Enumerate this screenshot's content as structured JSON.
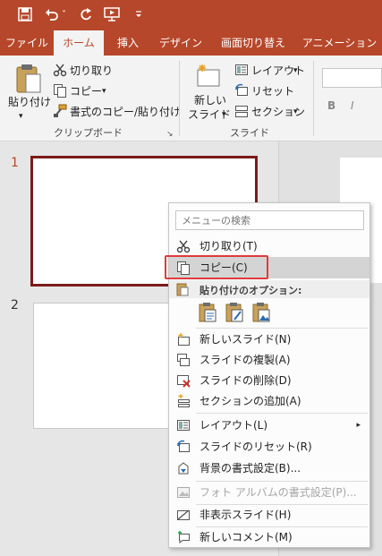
{
  "quick_access": {
    "save_icon": "save-icon",
    "undo_icon": "undo-icon",
    "redo_icon": "redo-icon",
    "present_icon": "present-from-start-icon",
    "customize_icon": "customize-qat-icon",
    "undo_dropdown": "˅"
  },
  "tabs": [
    {
      "label": "ファイル"
    },
    {
      "label": "ホーム"
    },
    {
      "label": "挿入"
    },
    {
      "label": "デザイン"
    },
    {
      "label": "画面切り替え"
    },
    {
      "label": "アニメーション"
    }
  ],
  "ribbon": {
    "clipboard": {
      "paste_label_1": "貼り付け",
      "paste_dropdown": "▾",
      "cut_label": "切り取り",
      "copy_label": "コピー",
      "copy_dropdown": "▾",
      "format_painter_label": "書式のコピー/貼り付け",
      "group_label": "クリップボード",
      "launcher": "↘"
    },
    "slides": {
      "new_slide_line1": "新しい",
      "new_slide_line2": "スライド",
      "new_slide_dropdown": "▾",
      "layout_label": "レイアウト",
      "layout_dropdown": "▾",
      "reset_label": "リセット",
      "section_label": "セクション",
      "section_dropdown": "▾",
      "group_label": "スライド"
    },
    "font": {
      "bold": "B",
      "italic": "I"
    }
  },
  "thumbnails": [
    {
      "number": "1"
    },
    {
      "number": "2"
    }
  ],
  "context_menu": {
    "search_placeholder": "メニューの検索",
    "items": {
      "cut": "切り取り(T)",
      "copy": "コピー(C)",
      "paste_options": "貼り付けのオプション:",
      "new_slide": "新しいスライド(N)",
      "duplicate_slide": "スライドの複製(A)",
      "delete_slide": "スライドの削除(D)",
      "add_section": "セクションの追加(A)",
      "layout": "レイアウト(L)",
      "reset_slide": "スライドのリセット(R)",
      "format_background": "背景の書式設定(B)...",
      "format_photo_album": "フォト アルバムの書式設定(P)...",
      "hide_slide": "非表示スライド(H)",
      "new_comment": "新しいコメント(M)"
    },
    "submenu_arrow": "▸"
  },
  "colors": {
    "accent": "#b7472a",
    "selection_border": "#7b1b1b",
    "highlight_outline": "#e03b3b"
  }
}
